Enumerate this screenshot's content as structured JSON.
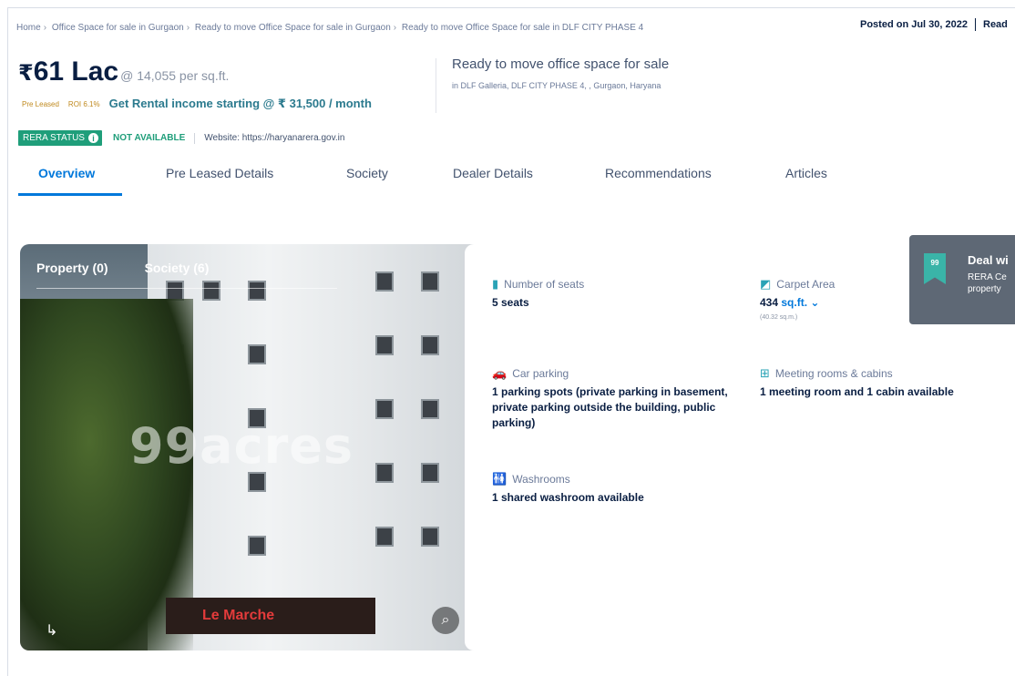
{
  "breadcrumb": [
    "Home",
    "Office Space for sale in Gurgaon",
    "Ready to move Office Space for sale in Gurgaon",
    "Ready to move Office Space for sale in DLF CITY PHASE 4"
  ],
  "posted": {
    "text": "Posted on Jul 30, 2022",
    "next": "Read"
  },
  "price": {
    "currency": "₹",
    "amount": "61 Lac",
    "per_sqft": "@ 14,055 per sq.ft."
  },
  "tags": {
    "pre_leased": "Pre Leased",
    "roi": "ROI 6.1%",
    "rental": "Get Rental income starting @ ₹ 31,500 / month"
  },
  "headline": {
    "title": "Ready to move office space for sale",
    "location": "in DLF Galleria, DLF CITY PHASE 4, , Gurgaon, Haryana"
  },
  "rera": {
    "badge": "RERA STATUS",
    "status": "NOT AVAILABLE",
    "website": "Website: https://haryanarera.gov.in"
  },
  "tabs": [
    "Overview",
    "Pre Leased Details",
    "Society",
    "Dealer Details",
    "Recommendations",
    "Articles"
  ],
  "gallery": {
    "tab_property": "Property (0)",
    "tab_society": "Society (6)",
    "watermark": "99acres",
    "shop_sign": "Le Marche"
  },
  "features": {
    "seats": {
      "label": "Number of seats",
      "value": "5 seats"
    },
    "carpet": {
      "label": "Carpet Area",
      "value": "434",
      "unit": "sq.ft.",
      "sub": "(40.32 sq.m.)"
    },
    "parking": {
      "label": "Car parking",
      "value": "1 parking spots (private parking in basement, private parking outside the building, public parking)"
    },
    "meeting": {
      "label": "Meeting rooms & cabins",
      "value": "1 meeting room and 1 cabin available"
    },
    "washrooms": {
      "label": "Washrooms",
      "value": "1 shared washroom available"
    }
  },
  "deal": {
    "badge": "99",
    "title": "Deal wi",
    "line1": "RERA Ce",
    "line2": "property"
  }
}
